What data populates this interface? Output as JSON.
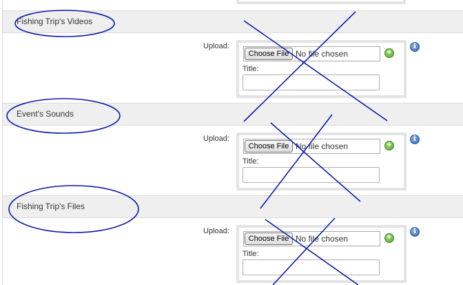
{
  "sections": [
    {
      "title": "Fishing Trip's Videos",
      "upload_label": "Upload:",
      "choose_file_label": "Choose File",
      "no_file_text": "No file chosen",
      "title_label": "Title:",
      "title_value": ""
    },
    {
      "title": "Event's Sounds",
      "upload_label": "Upload:",
      "choose_file_label": "Choose File",
      "no_file_text": "No file chosen",
      "title_label": "Title:",
      "title_value": ""
    },
    {
      "title": "Fishing Trip's Files",
      "upload_label": "Upload:",
      "choose_file_label": "Choose File",
      "no_file_text": "No file chosen",
      "title_label": "Title:",
      "title_value": ""
    }
  ],
  "icons": {
    "add": "plus-circle-icon",
    "info": "info-icon"
  },
  "colors": {
    "annotation": "#0a1aa8",
    "header_bg": "#efefef",
    "add_icon": "#4da12a",
    "info_icon": "#2f63b4"
  }
}
